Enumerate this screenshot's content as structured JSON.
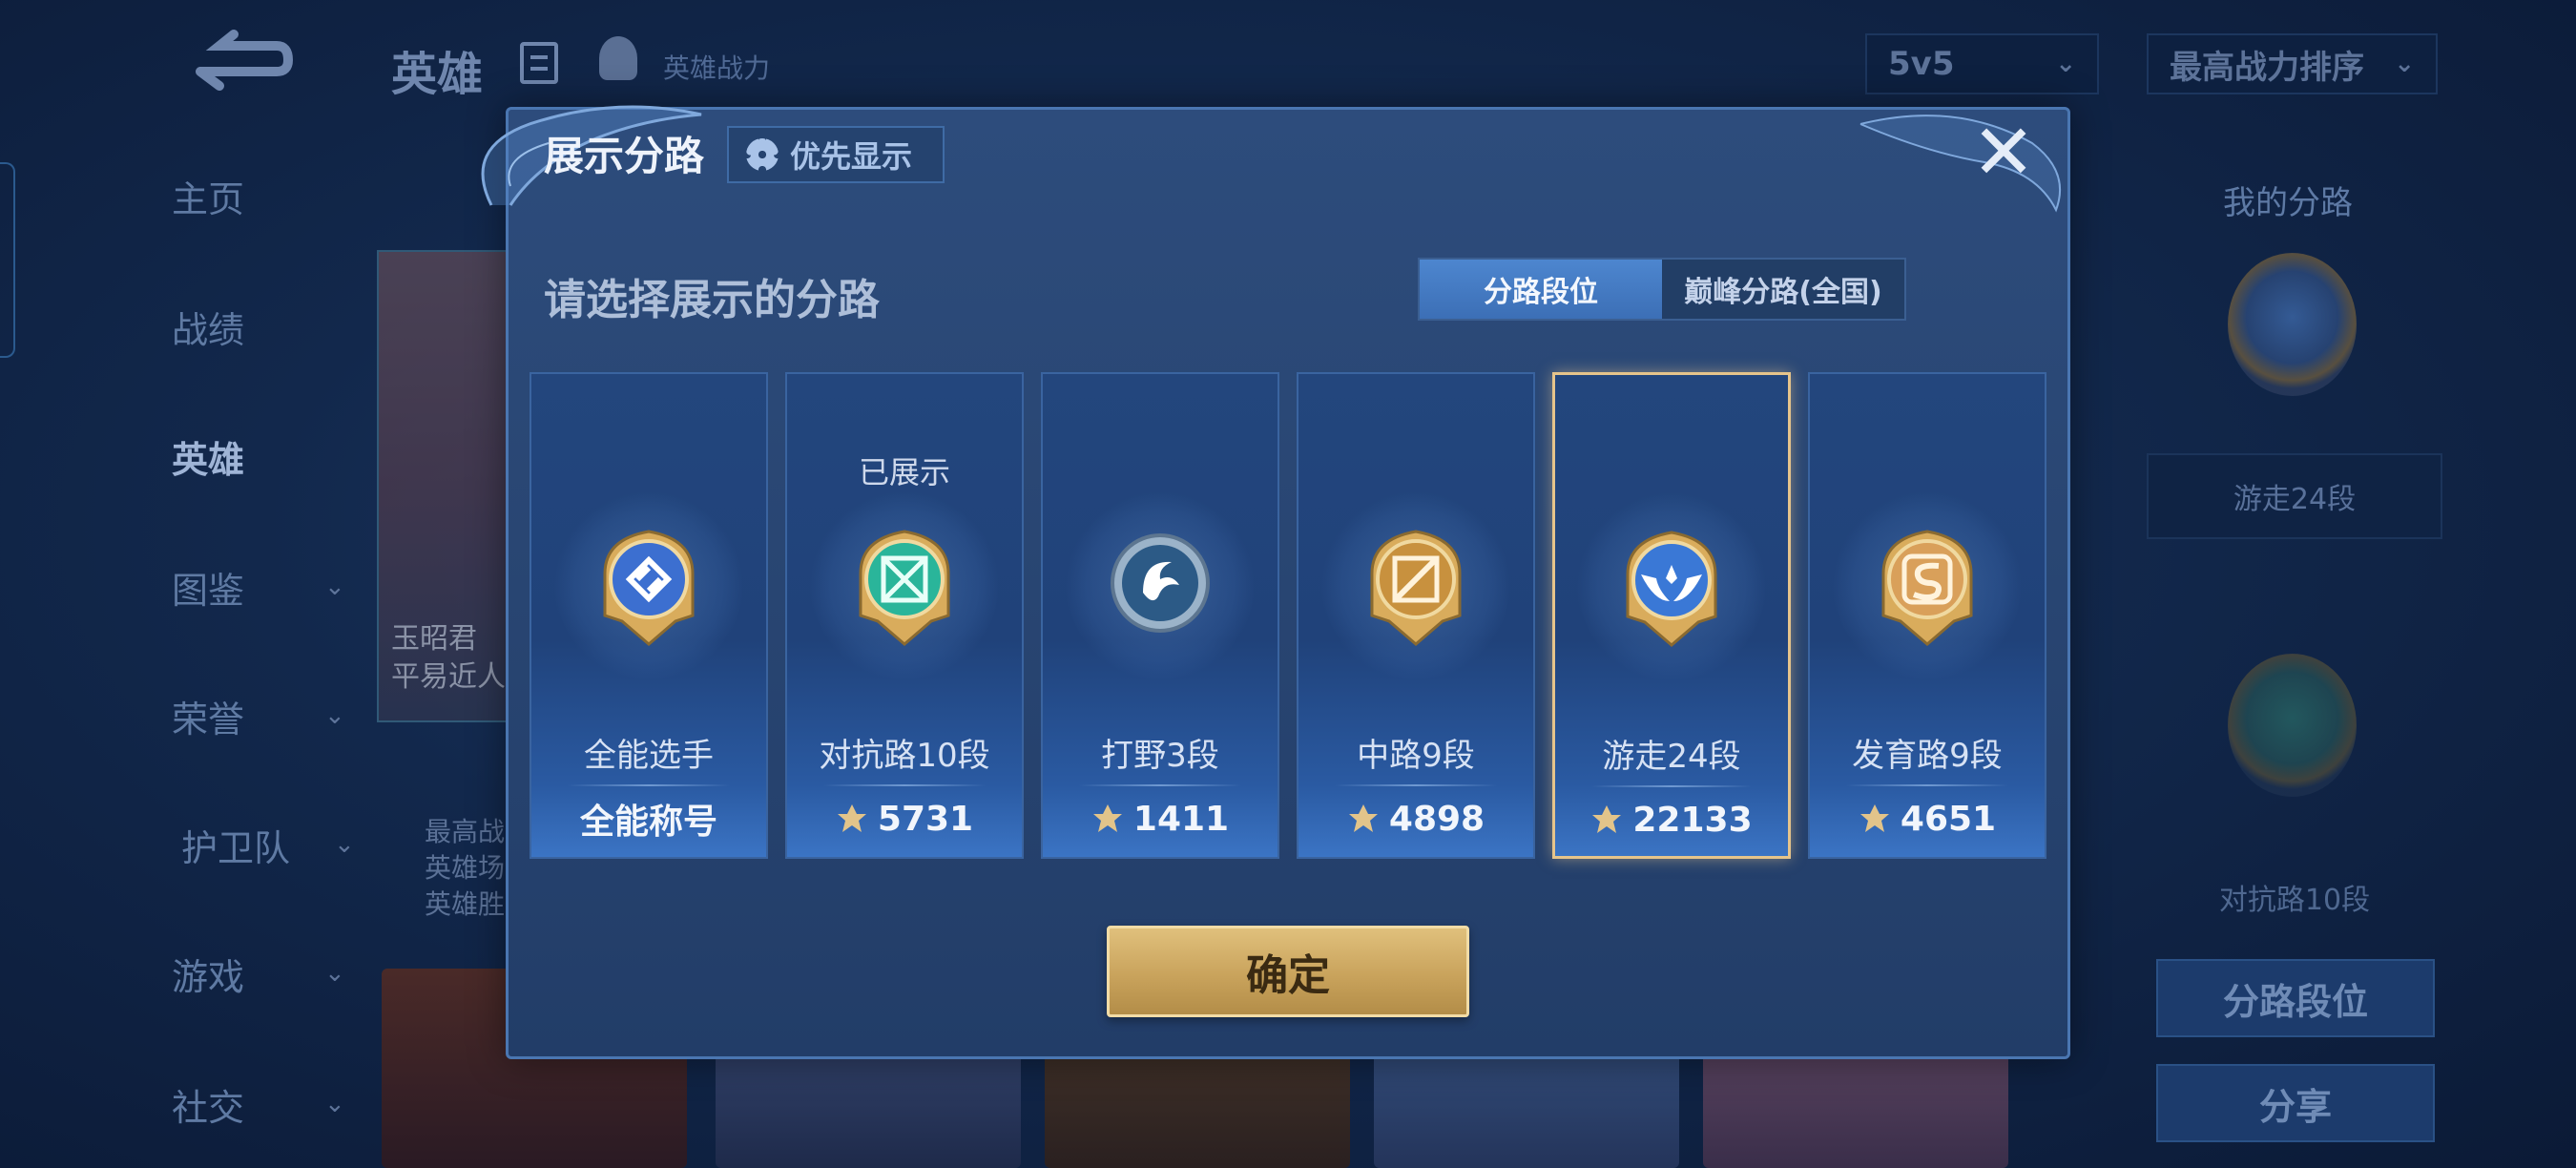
{
  "header": {
    "title": "英雄",
    "hero_power_label": "英雄战力",
    "mode_select": "5v5",
    "sort_select": "最高战力排序"
  },
  "side_nav": [
    {
      "label": "主页",
      "has_chevron": false
    },
    {
      "label": "战绩",
      "has_chevron": false
    },
    {
      "label": "英雄",
      "has_chevron": false,
      "active": true
    },
    {
      "label": "图鉴",
      "has_chevron": true
    },
    {
      "label": "荣誉",
      "has_chevron": true
    },
    {
      "label": "护卫队",
      "has_chevron": true
    },
    {
      "label": "游戏",
      "has_chevron": true
    },
    {
      "label": "社交",
      "has_chevron": true
    }
  ],
  "background": {
    "hero_card_text": [
      "玉昭君",
      "平易近人"
    ],
    "stats_lines": [
      "最高战",
      "英雄场",
      "英雄胜"
    ]
  },
  "right_panel": {
    "title": "我的分路",
    "rank_box": "游走24段",
    "rank_2": "对抗路10段",
    "lane_rank_button": "分路段位",
    "share_button": "分享"
  },
  "modal": {
    "title": "展示分路",
    "priority_button": "优先显示",
    "close_icon": "close-icon",
    "subtitle": "请选择展示的分路",
    "tabs": [
      {
        "label": "分路段位",
        "active": true
      },
      {
        "label": "巅峰分路(全国)",
        "active": false
      }
    ],
    "cards": [
      {
        "rank": "全能选手",
        "value": "全能称号",
        "show_power_icon": false,
        "shown_label": "",
        "selected": false,
        "emblem": "all-round-emblem",
        "color": "#3c6fd0"
      },
      {
        "rank": "对抗路10段",
        "value": "5731",
        "show_power_icon": true,
        "shown_label": "已展示",
        "selected": false,
        "emblem": "clash-lane-emblem",
        "color": "#2ab59a"
      },
      {
        "rank": "打野3段",
        "value": "1411",
        "show_power_icon": true,
        "shown_label": "",
        "selected": false,
        "emblem": "jungle-emblem",
        "color": "#7fa7c9"
      },
      {
        "rank": "中路9段",
        "value": "4898",
        "show_power_icon": true,
        "shown_label": "",
        "selected": false,
        "emblem": "mid-lane-emblem",
        "color": "#c8913e"
      },
      {
        "rank": "游走24段",
        "value": "22133",
        "show_power_icon": true,
        "shown_label": "",
        "selected": true,
        "emblem": "roam-emblem",
        "color": "#3a78d6"
      },
      {
        "rank": "发育路9段",
        "value": "4651",
        "show_power_icon": true,
        "shown_label": "",
        "selected": false,
        "emblem": "farm-lane-emblem",
        "color": "#d9a05a"
      }
    ],
    "confirm_button": "确定"
  },
  "colors": {
    "accent_blue": "#3c6fb6",
    "gold": "#c9a35c",
    "selected_border": "#e6c48b"
  }
}
